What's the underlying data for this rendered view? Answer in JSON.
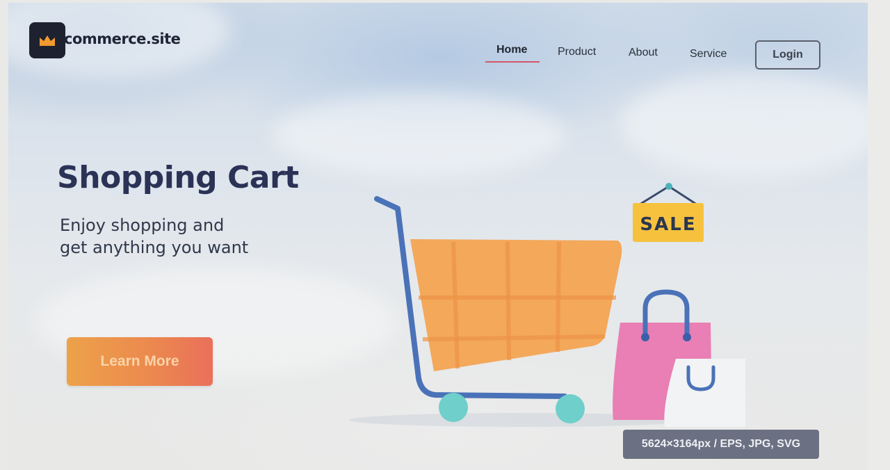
{
  "brand": {
    "name": "commerce.site",
    "logo_icon": "crown-icon"
  },
  "nav": {
    "items": [
      {
        "label": "Home",
        "active": true
      },
      {
        "label": "Product",
        "active": false
      },
      {
        "label": "About",
        "active": false
      },
      {
        "label": "Service",
        "active": false
      }
    ],
    "login_label": "Login"
  },
  "hero": {
    "title": "Shopping Cart",
    "subtitle_line1": "Enjoy shopping and",
    "subtitle_line2": "get anything you want",
    "cta_label": "Learn More"
  },
  "illustration": {
    "sale_tag": "SALE",
    "objects": [
      "shopping-cart-icon",
      "sale-tag-icon",
      "shopping-bag-icon"
    ]
  },
  "image_info": "5624×3164px / EPS, JPG, SVG",
  "colors": {
    "title": "#2a3256",
    "active_underline": "#d4566a",
    "cta_start": "#eda24a",
    "cta_end": "#e9705a",
    "cart_basket": "#f3a85a",
    "cart_frame": "#4a72b8",
    "cart_wheels": "#6ecfcb",
    "sale_tag": "#f6c23e",
    "bag": "#e97fb4"
  }
}
